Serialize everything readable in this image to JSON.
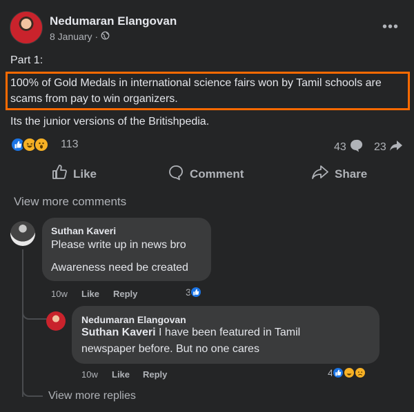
{
  "post": {
    "author": "Nedumaran Elangovan",
    "date": "8 January",
    "separator": "·",
    "more_label": "•••",
    "part_label": "Part 1:",
    "highlight_text": "100% of Gold Medals in international science fairs won by Tamil schools are scams from pay to win organizers.",
    "body_line": "Its the junior versions of the Britishpedia.",
    "reactions_count": "113",
    "comments_count": "43",
    "shares_count": "23",
    "highlight_color": "#ff6a00"
  },
  "actions": {
    "like": "Like",
    "comment": "Comment",
    "share": "Share"
  },
  "view_more_comments": "View more comments",
  "comments": [
    {
      "author": "Suthan Kaveri",
      "line1": "Please write up in news bro",
      "line2": "Awareness need be created",
      "time": "10w",
      "like": "Like",
      "reply": "Reply",
      "reactions": "3"
    },
    {
      "author": "Nedumaran Elangovan",
      "mention": "Suthan Kaveri",
      "line1_rest": " I have been featured in Tamil",
      "line2": "newspaper before. But no one cares",
      "time": "10w",
      "like": "Like",
      "reply": "Reply",
      "reactions": "4"
    }
  ],
  "view_more_replies": "View more replies",
  "icons": {
    "globe": "globe-icon",
    "like_reaction": "like-reaction-icon",
    "haha_reaction": "haha-reaction-icon",
    "wow_reaction": "wow-reaction-icon",
    "sad_reaction": "sad-reaction-icon"
  }
}
